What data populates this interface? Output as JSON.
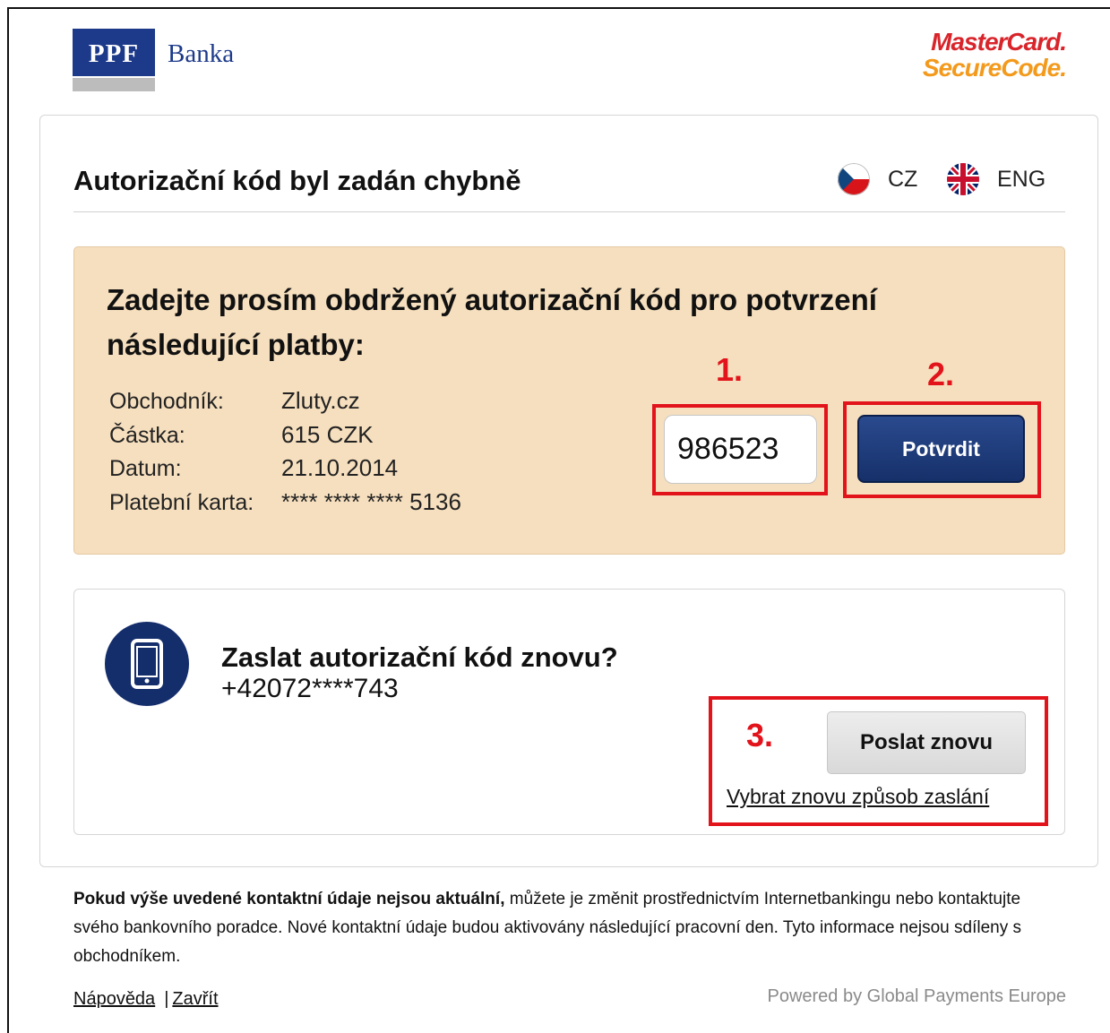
{
  "header": {
    "bank_logo": "PPF",
    "bank_name": "Banka",
    "secure_logo_line1": "MasterCard.",
    "secure_logo_line2": "SecureCode."
  },
  "page": {
    "title": "Autorizační kód byl zadán chybně"
  },
  "language": {
    "cz_label": "CZ",
    "eng_label": "ENG",
    "cz_icon": "czech-flag-icon",
    "eng_icon": "uk-flag-icon"
  },
  "payment": {
    "heading": "Zadejte prosím obdržený autorizační kód pro potvrzení následující platby:",
    "details": [
      {
        "label": "Obchodník:",
        "value": "Zluty.cz"
      },
      {
        "label": "Částka:",
        "value": "615 CZK"
      },
      {
        "label": "Datum:",
        "value": "21.10.2014"
      },
      {
        "label": "Platební karta:",
        "value": "**** **** **** 5136"
      }
    ],
    "code_value": "986523",
    "confirm_label": "Potvrdit"
  },
  "annotations": {
    "step1": "1.",
    "step2": "2.",
    "step3": "3.",
    "color": "#e2131a"
  },
  "resend": {
    "title": "Zaslat autorizační kód znovu?",
    "phone": "+42072****743",
    "button_label": "Poslat znovu",
    "change_method_link": "Vybrat znovu způsob zaslání",
    "icon": "mobile-phone-icon"
  },
  "footer": {
    "note_bold": "Pokud výše uvedené kontaktní údaje nejsou aktuální,",
    "note_rest": " můžete je změnit prostřednictvím Internetbankingu nebo kontaktujte svého bankovního poradce. Nové kontaktní údaje budou aktivovány následující pracovní den. Tyto informace nejsou sdíleny s obchodníkem.",
    "help_link": "Nápověda",
    "separator": "|",
    "close_link": "Zavřít",
    "powered_by": "Powered by Global Payments Europe"
  },
  "colors": {
    "brand_navy": "#1d3a8a",
    "panel_orange": "#f6dfbe",
    "mastercard_red": "#d8252b",
    "securecode_orange": "#f39a1d"
  }
}
